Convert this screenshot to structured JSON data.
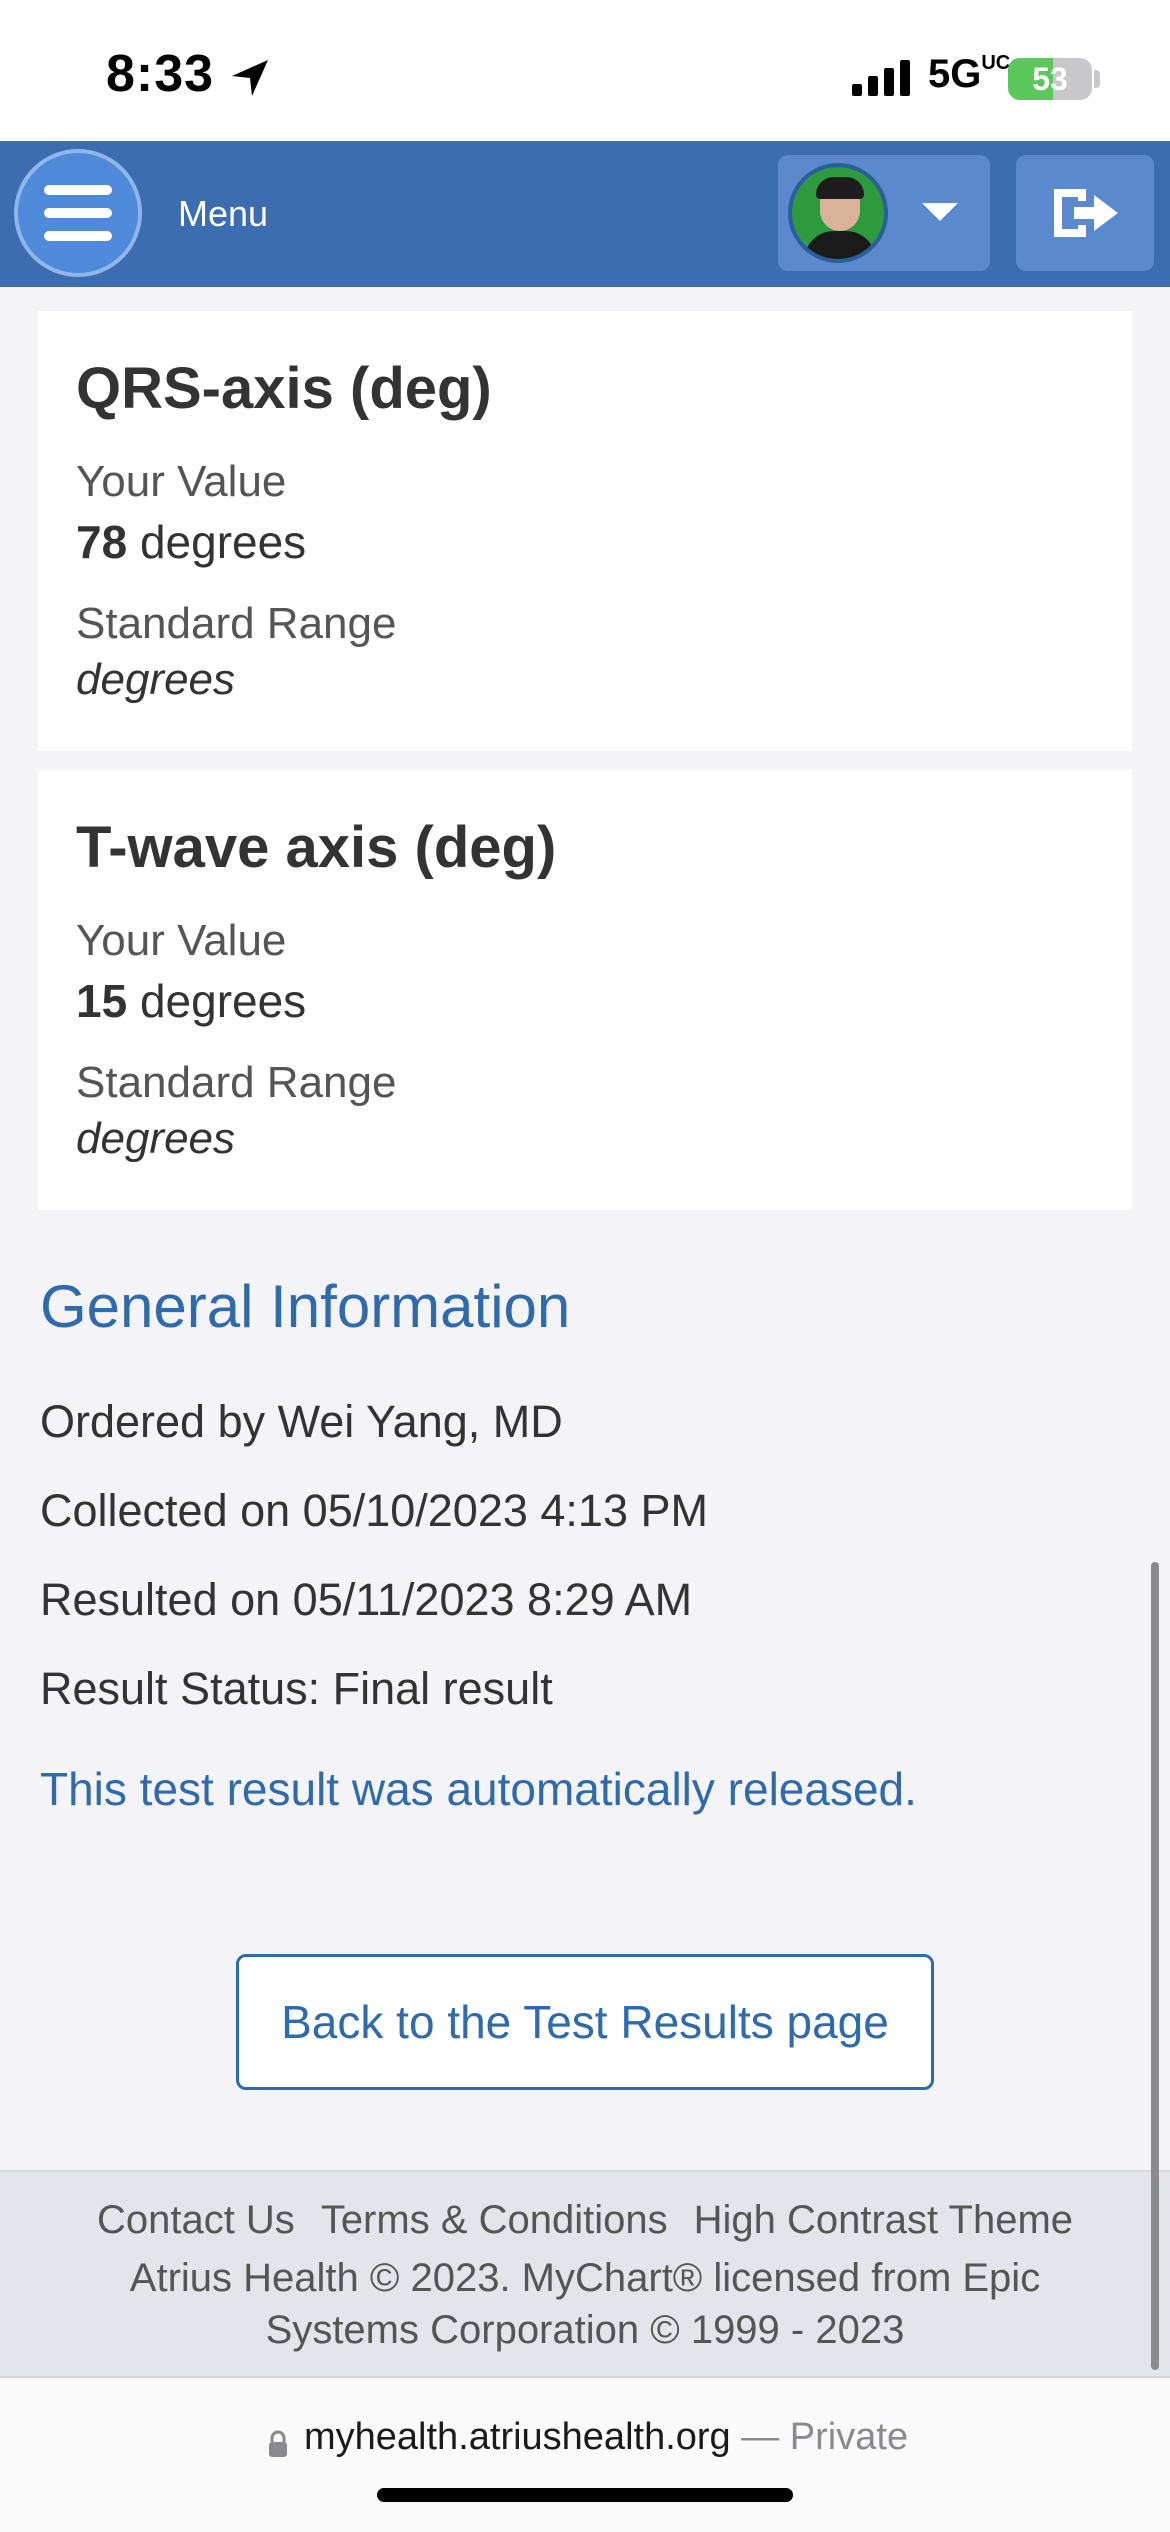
{
  "status_bar": {
    "time": "8:33",
    "network": "5G",
    "network_sup": "UC",
    "battery": "53",
    "battery_level_percent": 53,
    "battery_color": "#5ac85a"
  },
  "header": {
    "menu_label": "Menu",
    "brand_color": "#3b6db0"
  },
  "results": [
    {
      "title": "QRS-axis (deg)",
      "your_value_label": "Your Value",
      "value": "78",
      "unit": "degrees",
      "range_label": "Standard Range",
      "range_value": "degrees"
    },
    {
      "title": "T-wave axis (deg)",
      "your_value_label": "Your Value",
      "value": "15",
      "unit": "degrees",
      "range_label": "Standard Range",
      "range_value": "degrees"
    }
  ],
  "general_info": {
    "title": "General Information",
    "ordered_by": "Ordered by Wei Yang, MD",
    "collected": "Collected on 05/10/2023 4:13 PM",
    "resulted": "Resulted on 05/11/2023 8:29 AM",
    "status": "Result Status: Final result",
    "release_note": "This test result was automatically released."
  },
  "back_button": "Back to the Test Results page",
  "footer": {
    "links": [
      "Contact Us",
      "Terms & Conditions",
      "High Contrast Theme"
    ],
    "copyright_line1": "Atrius Health © 2023. MyChart® licensed from Epic",
    "copyright_line2": "Systems Corporation © 1999 - 2023"
  },
  "browser": {
    "url": "myhealth.atriushealth.org",
    "private_label": "— Private"
  }
}
